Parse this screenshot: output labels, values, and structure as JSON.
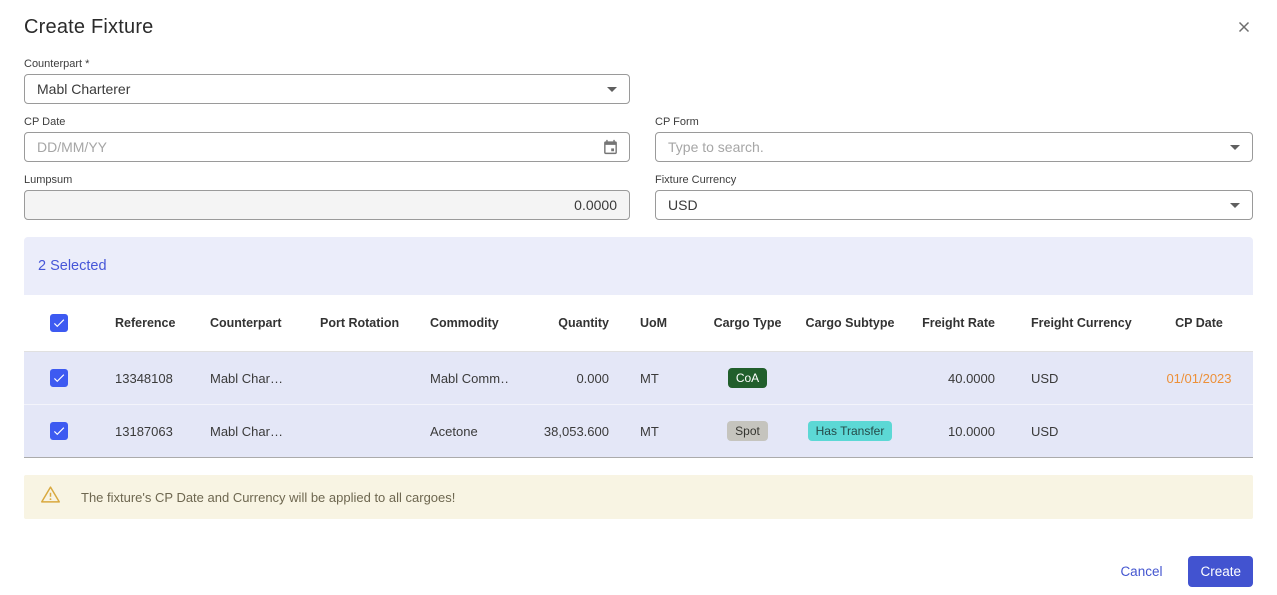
{
  "dialog": {
    "title": "Create Fixture"
  },
  "form": {
    "counterpart": {
      "label": "Counterpart *",
      "value": "Mabl Charterer"
    },
    "cp_date": {
      "label": "CP Date",
      "placeholder": "DD/MM/YY"
    },
    "cp_form": {
      "label": "CP Form",
      "placeholder": "Type to search."
    },
    "lumpsum": {
      "label": "Lumpsum",
      "value": "0.0000"
    },
    "fixture_currency": {
      "label": "Fixture Currency",
      "value": "USD"
    }
  },
  "table": {
    "selected_count": "2 Selected",
    "columns": [
      "Reference",
      "Counterpart",
      "Port Rotation",
      "Commodity",
      "Quantity",
      "UoM",
      "Cargo Type",
      "Cargo Subtype",
      "Freight Rate",
      "Freight Currency",
      "CP Date"
    ],
    "rows": [
      {
        "checked": true,
        "reference": "13348108",
        "counterpart": "Mabl Char…",
        "port_rotation": "",
        "commodity": "Mabl Comm…",
        "quantity": "0.000",
        "uom": "MT",
        "cargo_type": "CoA",
        "cargo_subtype": "",
        "freight_rate": "40.0000",
        "freight_currency": "USD",
        "cp_date": "01/01/2023"
      },
      {
        "checked": true,
        "reference": "13187063",
        "counterpart": "Mabl Char…",
        "port_rotation": "",
        "commodity": "Acetone",
        "quantity": "38,053.600",
        "uom": "MT",
        "cargo_type": "Spot",
        "cargo_subtype": "Has Transfer",
        "freight_rate": "10.0000",
        "freight_currency": "USD",
        "cp_date": ""
      }
    ]
  },
  "warning": {
    "message": "The fixture's CP Date and Currency will be applied to all cargoes!"
  },
  "actions": {
    "cancel_label": "Cancel",
    "create_label": "Create"
  },
  "colors": {
    "accent": "#4253d0",
    "checkbox": "#3d5af1",
    "selected_bar_bg": "#ebedfa",
    "selected_row_bg": "#e4e7f7",
    "warning_bg": "#f8f4e3",
    "warning_icon": "#d9a93f",
    "cp_date_highlight": "#ed9038",
    "badge_coa_bg": "#215f2c",
    "badge_spot_bg": "#c5c4be",
    "badge_has_transfer_bg": "#5cd8d5"
  }
}
